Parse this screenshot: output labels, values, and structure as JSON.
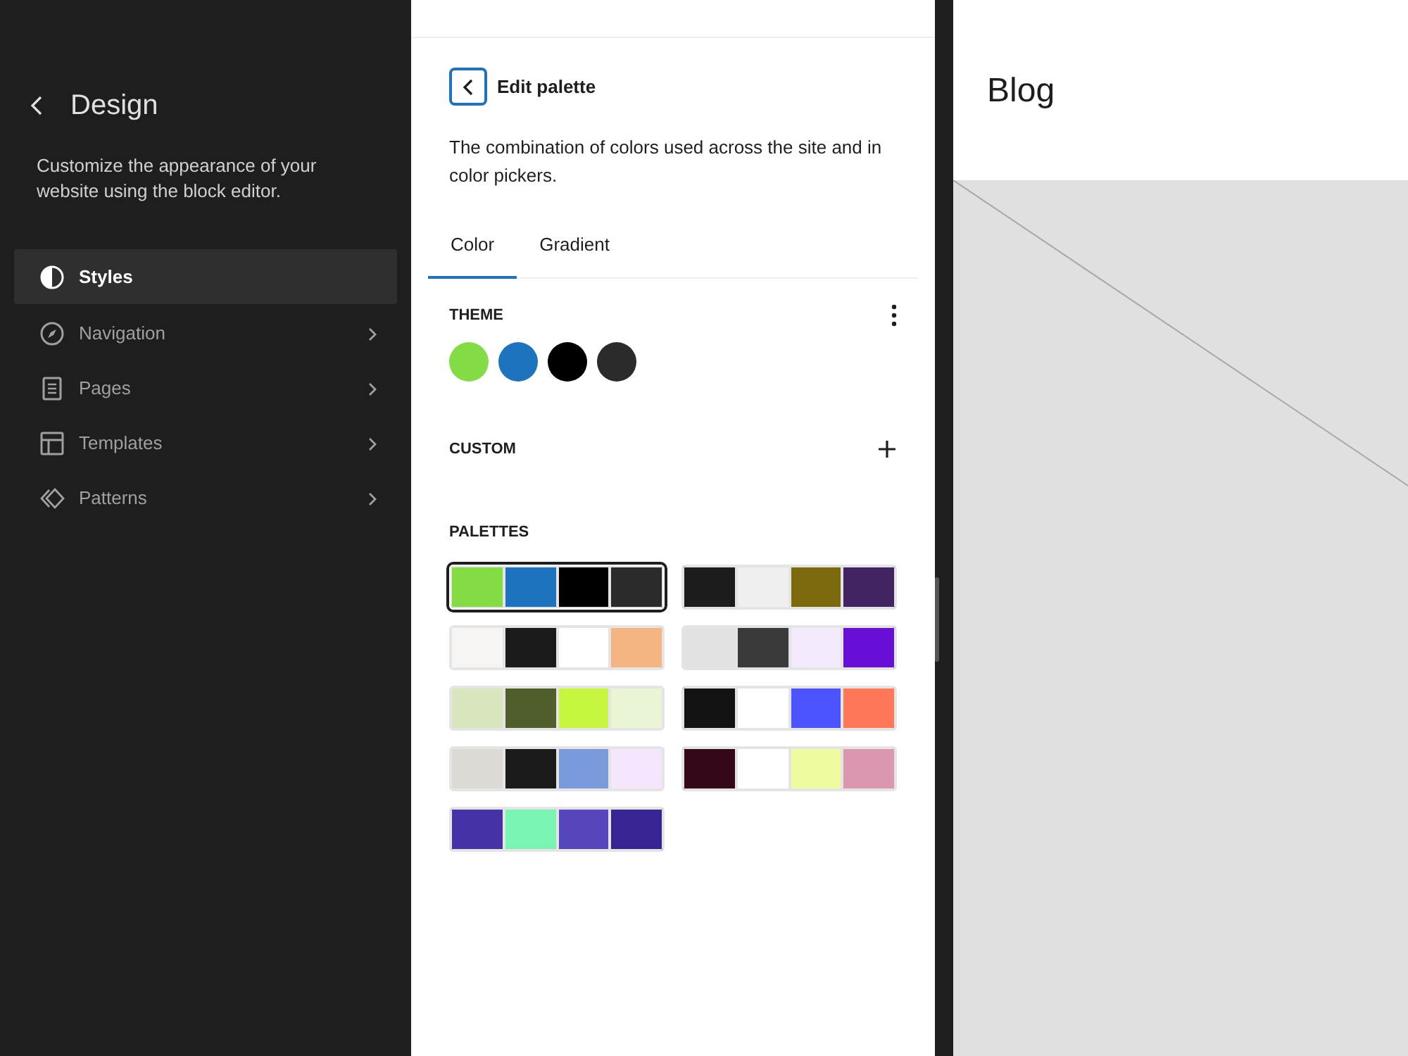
{
  "sidebar": {
    "title": "Design",
    "description": "Customize the appearance of your website using the block editor.",
    "items": [
      {
        "label": "Styles",
        "selected": true,
        "has_submenu": false
      },
      {
        "label": "Navigation",
        "selected": false,
        "has_submenu": true
      },
      {
        "label": "Pages",
        "selected": false,
        "has_submenu": true
      },
      {
        "label": "Templates",
        "selected": false,
        "has_submenu": true
      },
      {
        "label": "Patterns",
        "selected": false,
        "has_submenu": true
      }
    ]
  },
  "panel": {
    "heading": "Edit palette",
    "description": "The combination of colors used across the site and in color pickers.",
    "tabs": [
      {
        "label": "Color",
        "selected": true
      },
      {
        "label": "Gradient",
        "selected": false
      }
    ],
    "theme": {
      "label": "THEME",
      "colors": [
        {
          "color": "#84dc45"
        },
        {
          "color": "#1e73be"
        },
        {
          "color": "#000000"
        },
        {
          "color": "#2b2b2b"
        }
      ]
    },
    "custom": {
      "label": "CUSTOM"
    },
    "palettes": {
      "label": "PALETTES",
      "items": [
        {
          "selected": true,
          "colors": [
            {
              "color": "#84dc45"
            },
            {
              "color": "#1e73be"
            },
            {
              "color": "#000000"
            },
            {
              "color": "#2b2b2b"
            }
          ]
        },
        {
          "selected": false,
          "colors": [
            {
              "color": "#1c1c1c"
            },
            {
              "color": "#efefef"
            },
            {
              "color": "#7a6a0c"
            },
            {
              "color": "#432463"
            }
          ]
        },
        {
          "selected": false,
          "colors": [
            {
              "color": "#f6f5f3"
            },
            {
              "color": "#1b1b1b"
            },
            {
              "color": "#ffffff"
            },
            {
              "color": "#f5b583"
            }
          ]
        },
        {
          "selected": false,
          "colors": [
            {
              "color": "#e2e2e2"
            },
            {
              "color": "#3a3a3a"
            },
            {
              "color": "#f3ebfd"
            },
            {
              "color": "#6610d7"
            }
          ]
        },
        {
          "selected": false,
          "colors": [
            {
              "color": "#d9e5bd"
            },
            {
              "color": "#4f5e2b"
            },
            {
              "color": "#c6f73e"
            },
            {
              "color": "#e9f5d4"
            }
          ]
        },
        {
          "selected": false,
          "colors": [
            {
              "color": "#131313"
            },
            {
              "color": "#ffffff"
            },
            {
              "color": "#4b53fe"
            },
            {
              "color": "#fe7858"
            }
          ]
        },
        {
          "selected": false,
          "colors": [
            {
              "color": "#ddd9d4"
            },
            {
              "color": "#1b1b1b"
            },
            {
              "color": "#799bdb"
            },
            {
              "color": "#f5e5fd"
            }
          ]
        },
        {
          "selected": false,
          "colors": [
            {
              "color": "#340818"
            },
            {
              "color": "#ffffff"
            },
            {
              "color": "#f0fa9e"
            },
            {
              "color": "#db97b0"
            }
          ]
        },
        {
          "selected": false,
          "colors": [
            {
              "color": "#4432a6"
            },
            {
              "color": "#78f5b3"
            },
            {
              "color": "#5646bd"
            },
            {
              "color": "#382492"
            }
          ]
        }
      ]
    }
  },
  "preview": {
    "site_title": "Blog"
  }
}
